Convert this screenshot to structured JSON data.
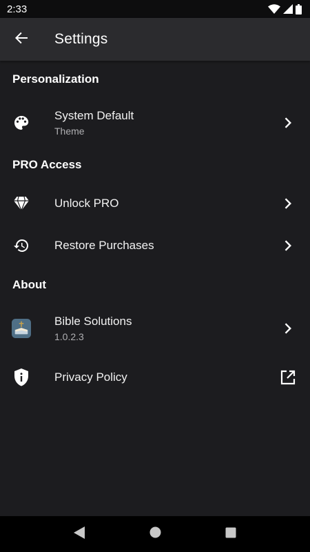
{
  "status_bar": {
    "time": "2:33",
    "icons": [
      "wifi-icon",
      "cellular-signal-icon",
      "battery-icon"
    ]
  },
  "app_bar": {
    "title": "Settings",
    "back_icon": "arrow-back-icon"
  },
  "sections": {
    "personalization": {
      "header": "Personalization",
      "theme": {
        "title": "System Default",
        "subtitle": "Theme",
        "icon": "palette-icon",
        "trailing": "chevron-right-icon"
      }
    },
    "pro": {
      "header": "PRO Access",
      "unlock": {
        "title": "Unlock PRO",
        "icon": "diamond-icon",
        "trailing": "chevron-right-icon"
      },
      "restore": {
        "title": "Restore Purchases",
        "icon": "history-icon",
        "trailing": "chevron-right-icon"
      }
    },
    "about": {
      "header": "About",
      "app": {
        "title": "Bible Solutions",
        "subtitle": "1.0.2.3",
        "icon": "app-logo-icon",
        "trailing": "chevron-right-icon"
      },
      "privacy": {
        "title": "Privacy Policy",
        "icon": "shield-info-icon",
        "trailing": "open-external-icon"
      }
    }
  },
  "nav_bar": {
    "icons": [
      "nav-back-icon",
      "nav-home-icon",
      "nav-recents-icon"
    ]
  },
  "colors": {
    "background": "#1c1c1f",
    "app_bar": "#2b2b2e",
    "status_bar": "#0d0d0e",
    "nav_bar": "#000000",
    "text_primary": "#f2f2f2",
    "text_secondary": "#b0b0b3"
  }
}
